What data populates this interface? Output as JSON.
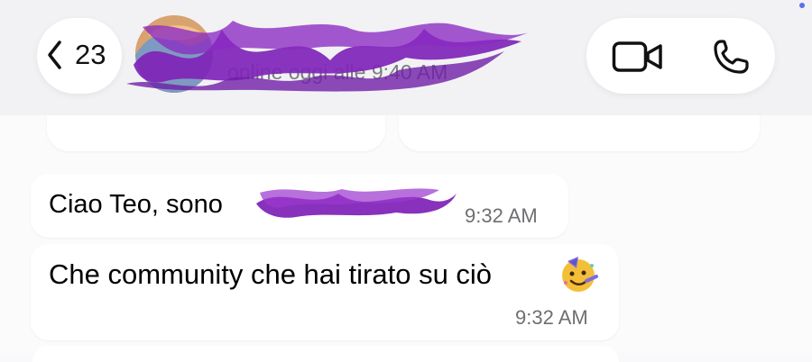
{
  "header": {
    "back_count": "23",
    "contact_name": "",
    "contact_status": "online oggi alle 9:40 AM"
  },
  "icons": {
    "back": "chevron-left-icon",
    "video": "video-call-icon",
    "phone": "phone-call-icon",
    "emoji": "party-face-emoji"
  },
  "messages": [
    {
      "text": "Ciao Teo, sono",
      "time": "9:32 AM"
    },
    {
      "text": "Che community che hai tirato su ciò",
      "time": "9:32 AM"
    }
  ],
  "colors": {
    "redaction": "#7f24b8",
    "header_bg": "#f1f1f4",
    "bubble_bg": "#ffffff",
    "timestamp": "#6f6f73"
  }
}
